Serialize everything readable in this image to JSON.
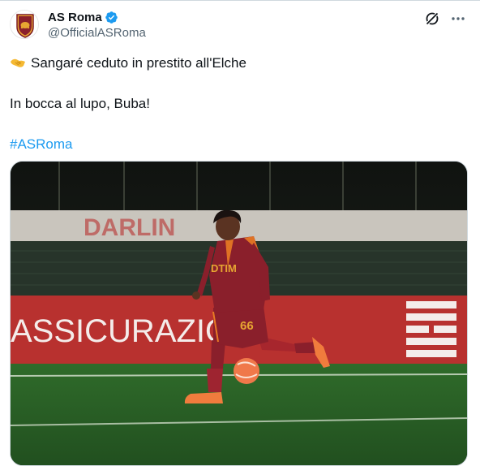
{
  "account": {
    "display_name": "AS Roma",
    "handle": "@OfficialASRoma",
    "verified_icon": "verified-badge-icon",
    "avatar_icon": "as-roma-crest-icon"
  },
  "actions": {
    "grok_icon": "grok-icon",
    "more_icon": "more-options-icon"
  },
  "tweet": {
    "line1_emoji": "handshake-emoji",
    "line1": "Sangaré ceduto in prestito all'Elche",
    "line2": "In bocca al lupo, Buba!",
    "hashtag": "#ASRoma"
  },
  "media": {
    "banner_text": "ASSICURAZIONI",
    "back_banner_text": "DARLIN",
    "shirt_sponsor": "DTIM",
    "shirt_number": "66",
    "colors": {
      "roma_red": "#8a1f2b",
      "roma_orange": "#e87b24",
      "banner_red": "#b8312f",
      "grass": "#2f6b2a"
    }
  }
}
